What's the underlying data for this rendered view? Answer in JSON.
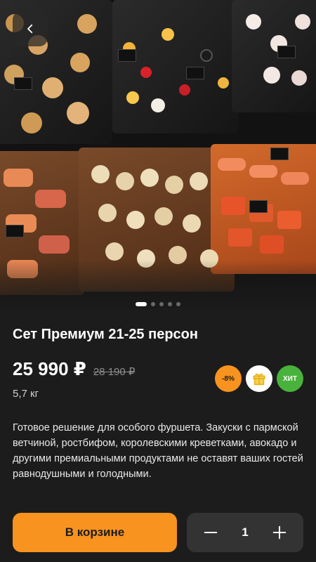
{
  "product": {
    "title": "Сет Премиум 21-25 персон",
    "price": "25 990 ₽",
    "old_price": "28 190 ₽",
    "weight": "5,7 кг",
    "description": "Готовое решение для особого фуршета. Закуски с пармской ветчиной, ростбифом, королевскими креветками, авокадо и другими премиальными продуктами не оставят ваших гостей равнодушными и голодными."
  },
  "badges": {
    "discount": "-8%",
    "gift_icon": "gift-icon",
    "hit": "ХИТ"
  },
  "colors": {
    "background": "#1c1c1c",
    "accent": "#f7931e",
    "hit_badge": "#49b23c",
    "stepper_bg": "#333333"
  },
  "actions": {
    "cart_label": "В корзине",
    "quantity": "1",
    "minus_icon": "minus-icon",
    "plus_icon": "plus-icon",
    "back_icon": "chevron-left-icon"
  },
  "gallery": {
    "slide_count": 5,
    "active_index": 0
  }
}
